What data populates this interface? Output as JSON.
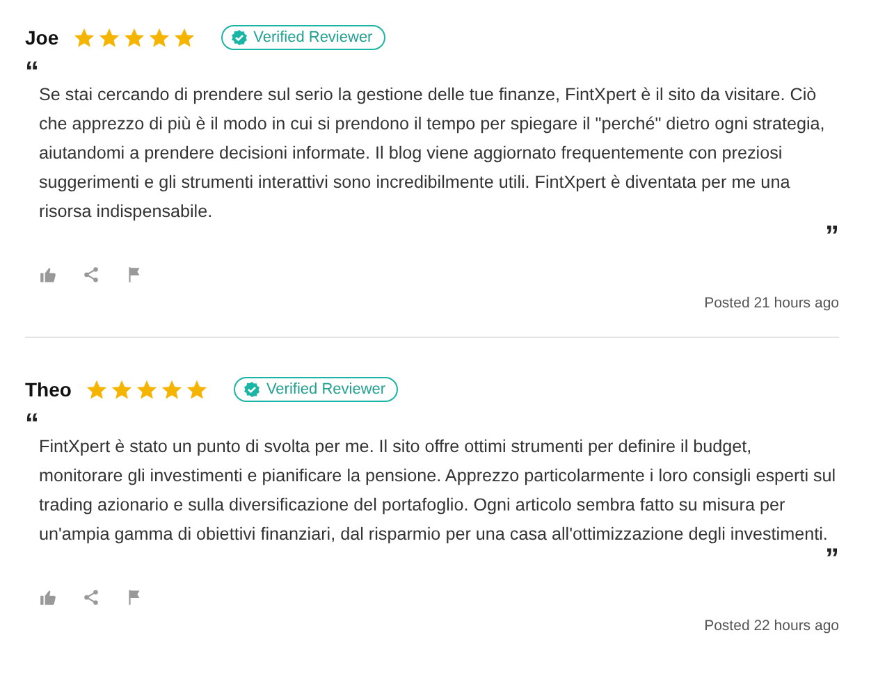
{
  "reviews": [
    {
      "name": "Joe",
      "stars": 5,
      "badge": "Verified Reviewer",
      "open_quote": "“",
      "text": "Se stai cercando di prendere sul serio la gestione delle tue finanze, FintXpert è il sito da visitare.  Ciò che apprezzo di più è il modo in cui si prendono il tempo per spiegare il \"perché\" dietro ogni strategia, aiutandomi a prendere decisioni informate. Il blog viene aggiornato frequentemente con preziosi suggerimenti e gli strumenti interattivi sono incredibilmente utili. FintXpert è diventata per me una risorsa indispensabile.",
      "close_quote": "”",
      "posted": "Posted 21 hours ago"
    },
    {
      "name": "Theo",
      "stars": 5,
      "badge": "Verified Reviewer",
      "open_quote": "“",
      "text": "FintXpert è stato un punto di svolta per me. Il sito offre ottimi strumenti per definire il budget, monitorare gli investimenti e pianificare la pensione. Apprezzo particolarmente i loro consigli esperti sul trading azionario e sulla diversificazione del portafoglio. Ogni articolo sembra fatto su misura per un'ampia gamma di obiettivi finanziari, dal risparmio per una casa all'ottimizzazione degli investimenti.",
      "close_quote": "”",
      "posted": "Posted 22 hours ago"
    }
  ]
}
